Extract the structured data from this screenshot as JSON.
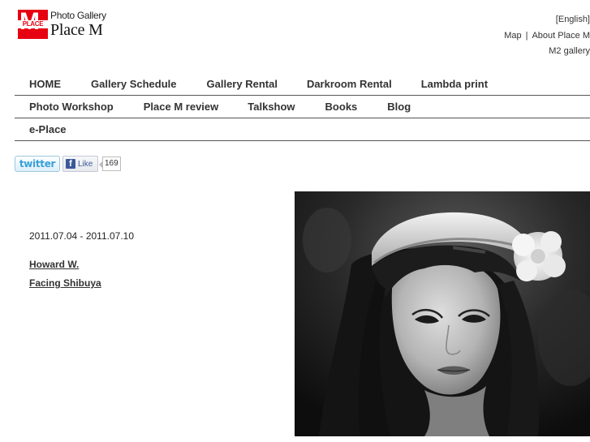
{
  "logo": {
    "mark_letter": "M",
    "mark_word": "PLACE",
    "subtitle": "Photo Gallery",
    "title": "Place M"
  },
  "toplinks": {
    "english": "[English]",
    "map": "Map",
    "separator": "|",
    "about": "About Place M",
    "m2": "M2 gallery"
  },
  "nav": {
    "row1": [
      "HOME",
      "Gallery Schedule",
      "Gallery Rental",
      "Darkroom Rental",
      "Lambda print"
    ],
    "row2": [
      "Photo Workshop",
      "Place M review",
      "Talkshow",
      "Books",
      "Blog"
    ],
    "row3": [
      "e-Place"
    ]
  },
  "social": {
    "twitter_label": "twitter",
    "facebook_glyph": "f",
    "facebook_label": "Like",
    "facebook_count": "169"
  },
  "exhibition": {
    "date": "2011.07.04 - 2011.07.10",
    "artist": "Howard W.",
    "title": "Facing Shibuya"
  },
  "colors": {
    "brand_red": "#e60012",
    "twitter_blue": "#36a0d8",
    "facebook_blue": "#3b5998"
  }
}
